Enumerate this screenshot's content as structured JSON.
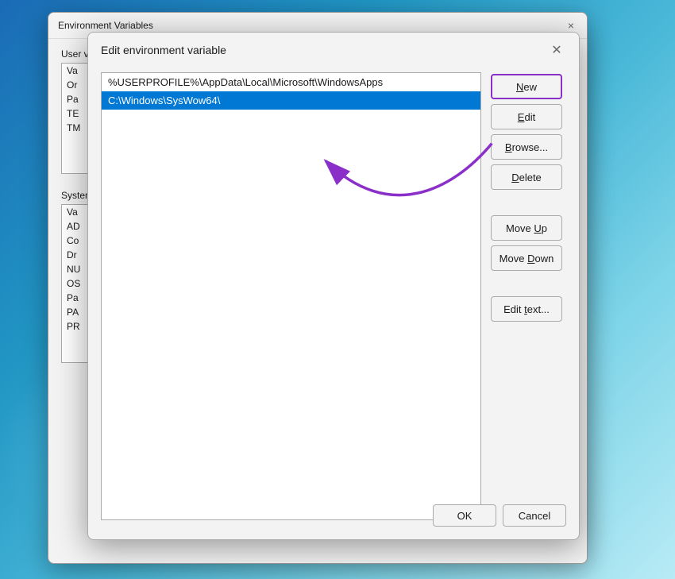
{
  "background": {
    "color_start": "#0078d4",
    "color_end": "#caf0f8"
  },
  "env_dialog": {
    "title": "Environment Variables",
    "close_icon": "×",
    "user_section_label": "User variables for User",
    "user_vars": [
      {
        "name": "Va",
        "value": ""
      },
      {
        "name": "Or",
        "value": ""
      },
      {
        "name": "Pa",
        "value": ""
      },
      {
        "name": "TE",
        "value": ""
      },
      {
        "name": "TM",
        "value": ""
      }
    ],
    "system_section_label": "System variables",
    "system_vars": [
      {
        "name": "Va",
        "value": ""
      },
      {
        "name": "AD",
        "value": ""
      },
      {
        "name": "Co",
        "value": ""
      },
      {
        "name": "Dr",
        "value": ""
      },
      {
        "name": "NU",
        "value": ""
      },
      {
        "name": "OS",
        "value": ""
      },
      {
        "name": "Pa",
        "value": ""
      },
      {
        "name": "PA",
        "value": ""
      },
      {
        "name": "PR",
        "value": ""
      }
    ]
  },
  "edit_dialog": {
    "title": "Edit environment variable",
    "close_icon": "×",
    "path_items": [
      {
        "text": "%USERPROFILE%\\AppData\\Local\\Microsoft\\WindowsApps",
        "selected": false
      },
      {
        "text": "C:\\Windows\\SysWow64\\",
        "selected": true
      }
    ],
    "buttons": [
      {
        "label": "New",
        "id": "new-btn",
        "highlighted": true,
        "underline_index": 0
      },
      {
        "label": "Edit",
        "id": "edit-btn",
        "highlighted": false,
        "underline_index": 0
      },
      {
        "label": "Browse...",
        "id": "browse-btn",
        "highlighted": false,
        "underline_index": 0
      },
      {
        "label": "Delete",
        "id": "delete-btn",
        "highlighted": false,
        "underline_index": 0
      },
      {
        "label": "Move Up",
        "id": "move-up-btn",
        "highlighted": false,
        "underline_index": 5
      },
      {
        "label": "Move Down",
        "id": "move-down-btn",
        "highlighted": false,
        "underline_index": 5
      },
      {
        "label": "Edit text...",
        "id": "edit-text-btn",
        "highlighted": false,
        "underline_index": 5
      }
    ],
    "bottom_buttons": [
      {
        "label": "OK",
        "id": "ok-btn"
      },
      {
        "label": "Cancel",
        "id": "cancel-btn"
      }
    ]
  },
  "arrow": {
    "color": "#8b2fc9",
    "from_label": "New button",
    "to_label": "selected path item"
  }
}
